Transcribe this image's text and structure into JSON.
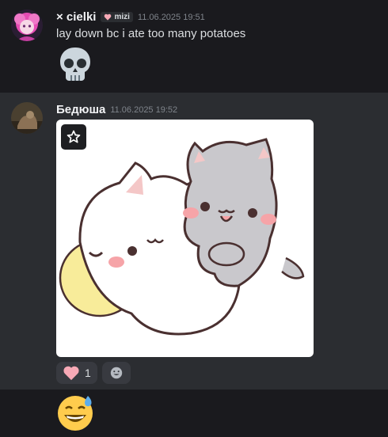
{
  "messages": [
    {
      "author": "× cielki",
      "role_tag": "mizi",
      "timestamp": "11.06.2025 19:51",
      "text": "lay down bc i ate too many potatoes",
      "emoji": "skull"
    },
    {
      "author": "Бедюша",
      "timestamp": "11.06.2025 19:52",
      "attachment": "peach-goma-hug-sticker",
      "reactions": [
        {
          "emoji": "heart",
          "count": "1"
        }
      ]
    },
    {
      "emoji": "sweat-smile"
    }
  ],
  "icons": {
    "star": "star-icon",
    "add_reaction": "smiley-icon"
  },
  "colors": {
    "bg": "#1a1a1e",
    "highlight": "#2b2d31",
    "heart": "#f7a9b6",
    "reaction_bg": "#383a40"
  }
}
